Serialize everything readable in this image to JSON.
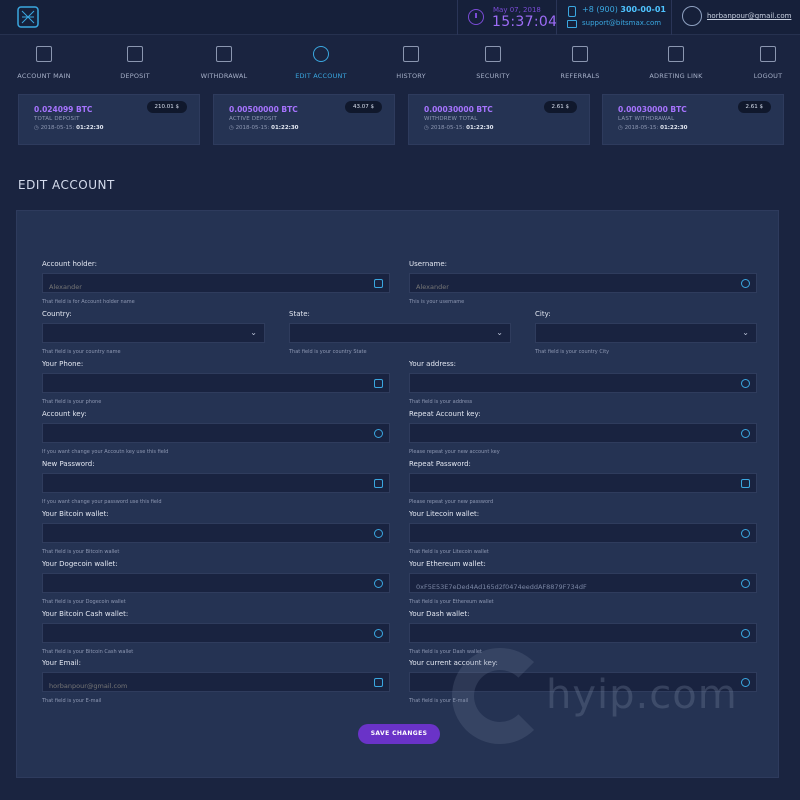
{
  "header": {
    "date": "May 07, 2018",
    "time": "15:37:04",
    "phone_prefix": "+8 (900) ",
    "phone_number": "300-00-01",
    "email": "support@bitsmax.com",
    "username": "horbanpour@gmail.com"
  },
  "nav": [
    {
      "label": "ACCOUNT MAIN",
      "icon": "home-icon"
    },
    {
      "label": "DEPOSIT",
      "icon": "safe-icon"
    },
    {
      "label": "WITHDRAWAL",
      "icon": "coins-icon"
    },
    {
      "label": "EDIT ACCOUNT",
      "icon": "gear-icon",
      "active": true
    },
    {
      "label": "HISTORY",
      "icon": "calendar-icon"
    },
    {
      "label": "SECURITY",
      "icon": "lock-icon"
    },
    {
      "label": "REFERRALS",
      "icon": "users-icon"
    },
    {
      "label": "ADRETING LINK",
      "icon": "link-icon"
    },
    {
      "label": "LOGOUT",
      "icon": "logout-icon"
    }
  ],
  "cards": [
    {
      "amount": "0.024099 BTC",
      "label": "TOTAL DEPOSIT",
      "date": "2018-05-15:",
      "time": "01:22:30",
      "badge": "210.01 $"
    },
    {
      "amount": "0.00500000 BTC",
      "label": "ACTIVE DEPOSIT",
      "date": "2018-05-15:",
      "time": "01:22:30",
      "badge": "43.07 $"
    },
    {
      "amount": "0.00030000 BTC",
      "label": "WITHDREW TOTAL",
      "date": "2018-05-15:",
      "time": "01:22:30",
      "badge": "2.61 $"
    },
    {
      "amount": "0.00030000 BTC",
      "label": "LAST WITHDRAWAL",
      "date": "2018-05-15:",
      "time": "01:22:30",
      "badge": "2.61 $"
    }
  ],
  "section_title": "EDIT ACCOUNT",
  "form": {
    "account_holder": {
      "label": "Account holder:",
      "placeholder": "Alexander",
      "hint": "That field is for Account holder name",
      "icon": "id-card-icon"
    },
    "username": {
      "label": "Username:",
      "placeholder": "Alexander",
      "hint": "This is your username",
      "icon": "user-icon"
    },
    "country": {
      "label": "Country:",
      "hint": "That field is your country name"
    },
    "state": {
      "label": "State:",
      "hint": "That field is your country State"
    },
    "city": {
      "label": "City:",
      "hint": "That field is your country City"
    },
    "phone": {
      "label": "Your Phone:",
      "hint": "That field is your phone",
      "icon": "phone-icon"
    },
    "address": {
      "label": "Your address:",
      "hint": "That field is your address",
      "icon": "location-icon"
    },
    "account_key": {
      "label": "Account key:",
      "hint": "If you want change your Accoutn key use this field",
      "icon": "key-icon"
    },
    "repeat_account_key": {
      "label": "Repeat Account key:",
      "hint": "Please repeat your new account key",
      "icon": "key-icon"
    },
    "new_password": {
      "label": "New Password:",
      "hint": "If you want change your password use this field",
      "icon": "lock-icon"
    },
    "repeat_password": {
      "label": "Repeat Password:",
      "hint": "Please repeat your new password",
      "icon": "lock-icon"
    },
    "bitcoin_wallet": {
      "label": "Your Bitcoin wallet:",
      "hint": "That field is your Bitcoin wallet",
      "icon": "bitcoin-icon"
    },
    "litecoin_wallet": {
      "label": "Your Litecoin wallet:",
      "hint": "That field is your Litecoin wallet",
      "icon": "litecoin-icon"
    },
    "dogecoin_wallet": {
      "label": "Your Dogecoin wallet:",
      "hint": "That field is your Dogecoin wallet",
      "icon": "dogecoin-icon"
    },
    "ethereum_wallet": {
      "label": "Your Ethereum wallet:",
      "value": "0xF5E53E7eDed4Ad165d2f0474eeddAF8879F734dF",
      "hint": "That field is your Ethereum wallet",
      "icon": "ethereum-icon"
    },
    "bitcoin_cash_wallet": {
      "label": "Your Bitcoin Cash wallet:",
      "hint": "That field is your Bitcoin Cash wallet",
      "icon": "bitcoin-icon"
    },
    "dash_wallet": {
      "label": "Your Dash wallet:",
      "hint": "That field is your Dash wallet",
      "icon": "dash-icon"
    },
    "email": {
      "label": "Your Email:",
      "placeholder": "horbanpour@gmail.com",
      "hint": "That field is your E-mail",
      "icon": "car-icon"
    },
    "current_account_key": {
      "label": "Your current account key:",
      "hint": "That field is your E-mail",
      "icon": "key-icon"
    }
  },
  "save_label": "SAVE CHANGES",
  "watermark": "hyip.com",
  "colors": {
    "accent_purple": "#9d6cf7",
    "accent_blue": "#3aa7e0",
    "button": "#6a33c8",
    "bg": "#1a2440",
    "panel": "#253353"
  }
}
